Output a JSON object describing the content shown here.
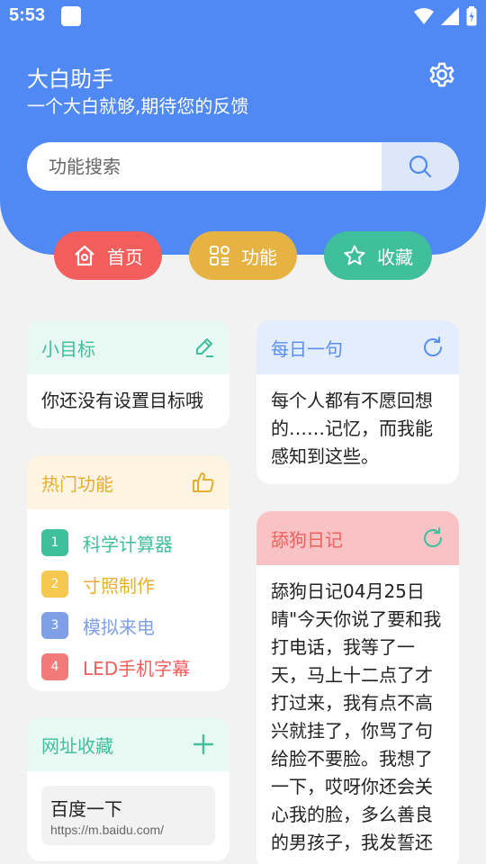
{
  "status_bar": {
    "time": "5:53"
  },
  "header": {
    "title": "大白助手",
    "subtitle": "一个大白就够,期待您的反馈"
  },
  "search": {
    "placeholder": "功能搜索"
  },
  "nav": {
    "home": {
      "label": "首页",
      "color": "#f25e5c"
    },
    "functions": {
      "label": "功能",
      "color": "#e6b343"
    },
    "favorites": {
      "label": "收藏",
      "color": "#3fbf9b"
    }
  },
  "goal_card": {
    "title": "小目标",
    "content": "你还没有设置目标哦"
  },
  "hot_card": {
    "title": "热门功能",
    "items": [
      {
        "num": "1",
        "label": "科学计算器",
        "color": "#3fbf9b"
      },
      {
        "num": "2",
        "label": "寸照制作",
        "color": "#e8ae2e"
      },
      {
        "num": "3",
        "label": "模拟来电",
        "color": "#7f9fe6"
      },
      {
        "num": "4",
        "label": "LED手机字幕",
        "color": "#f25e5c"
      }
    ]
  },
  "url_card": {
    "title": "网址收藏",
    "items": [
      {
        "name": "百度一下",
        "url": "https://m.baidu.com/"
      }
    ]
  },
  "daily_card": {
    "title": "每日一句",
    "content": "每个人都有不愿回想的……记忆，而我能感知到这些。"
  },
  "diary_card": {
    "title": "舔狗日记",
    "content": "舔狗日记04月25日晴\"今天你说了要和我打电话，我等了一天，马上十二点了才打过来，我有点不高兴就挂了，你骂了句给脸不要脸。我想了一下，哎呀你还会关心我的脸，多么善良的男孩子，我发誓还"
  },
  "colors": {
    "primary": "#5089f3",
    "background": "#f2f2f2"
  }
}
